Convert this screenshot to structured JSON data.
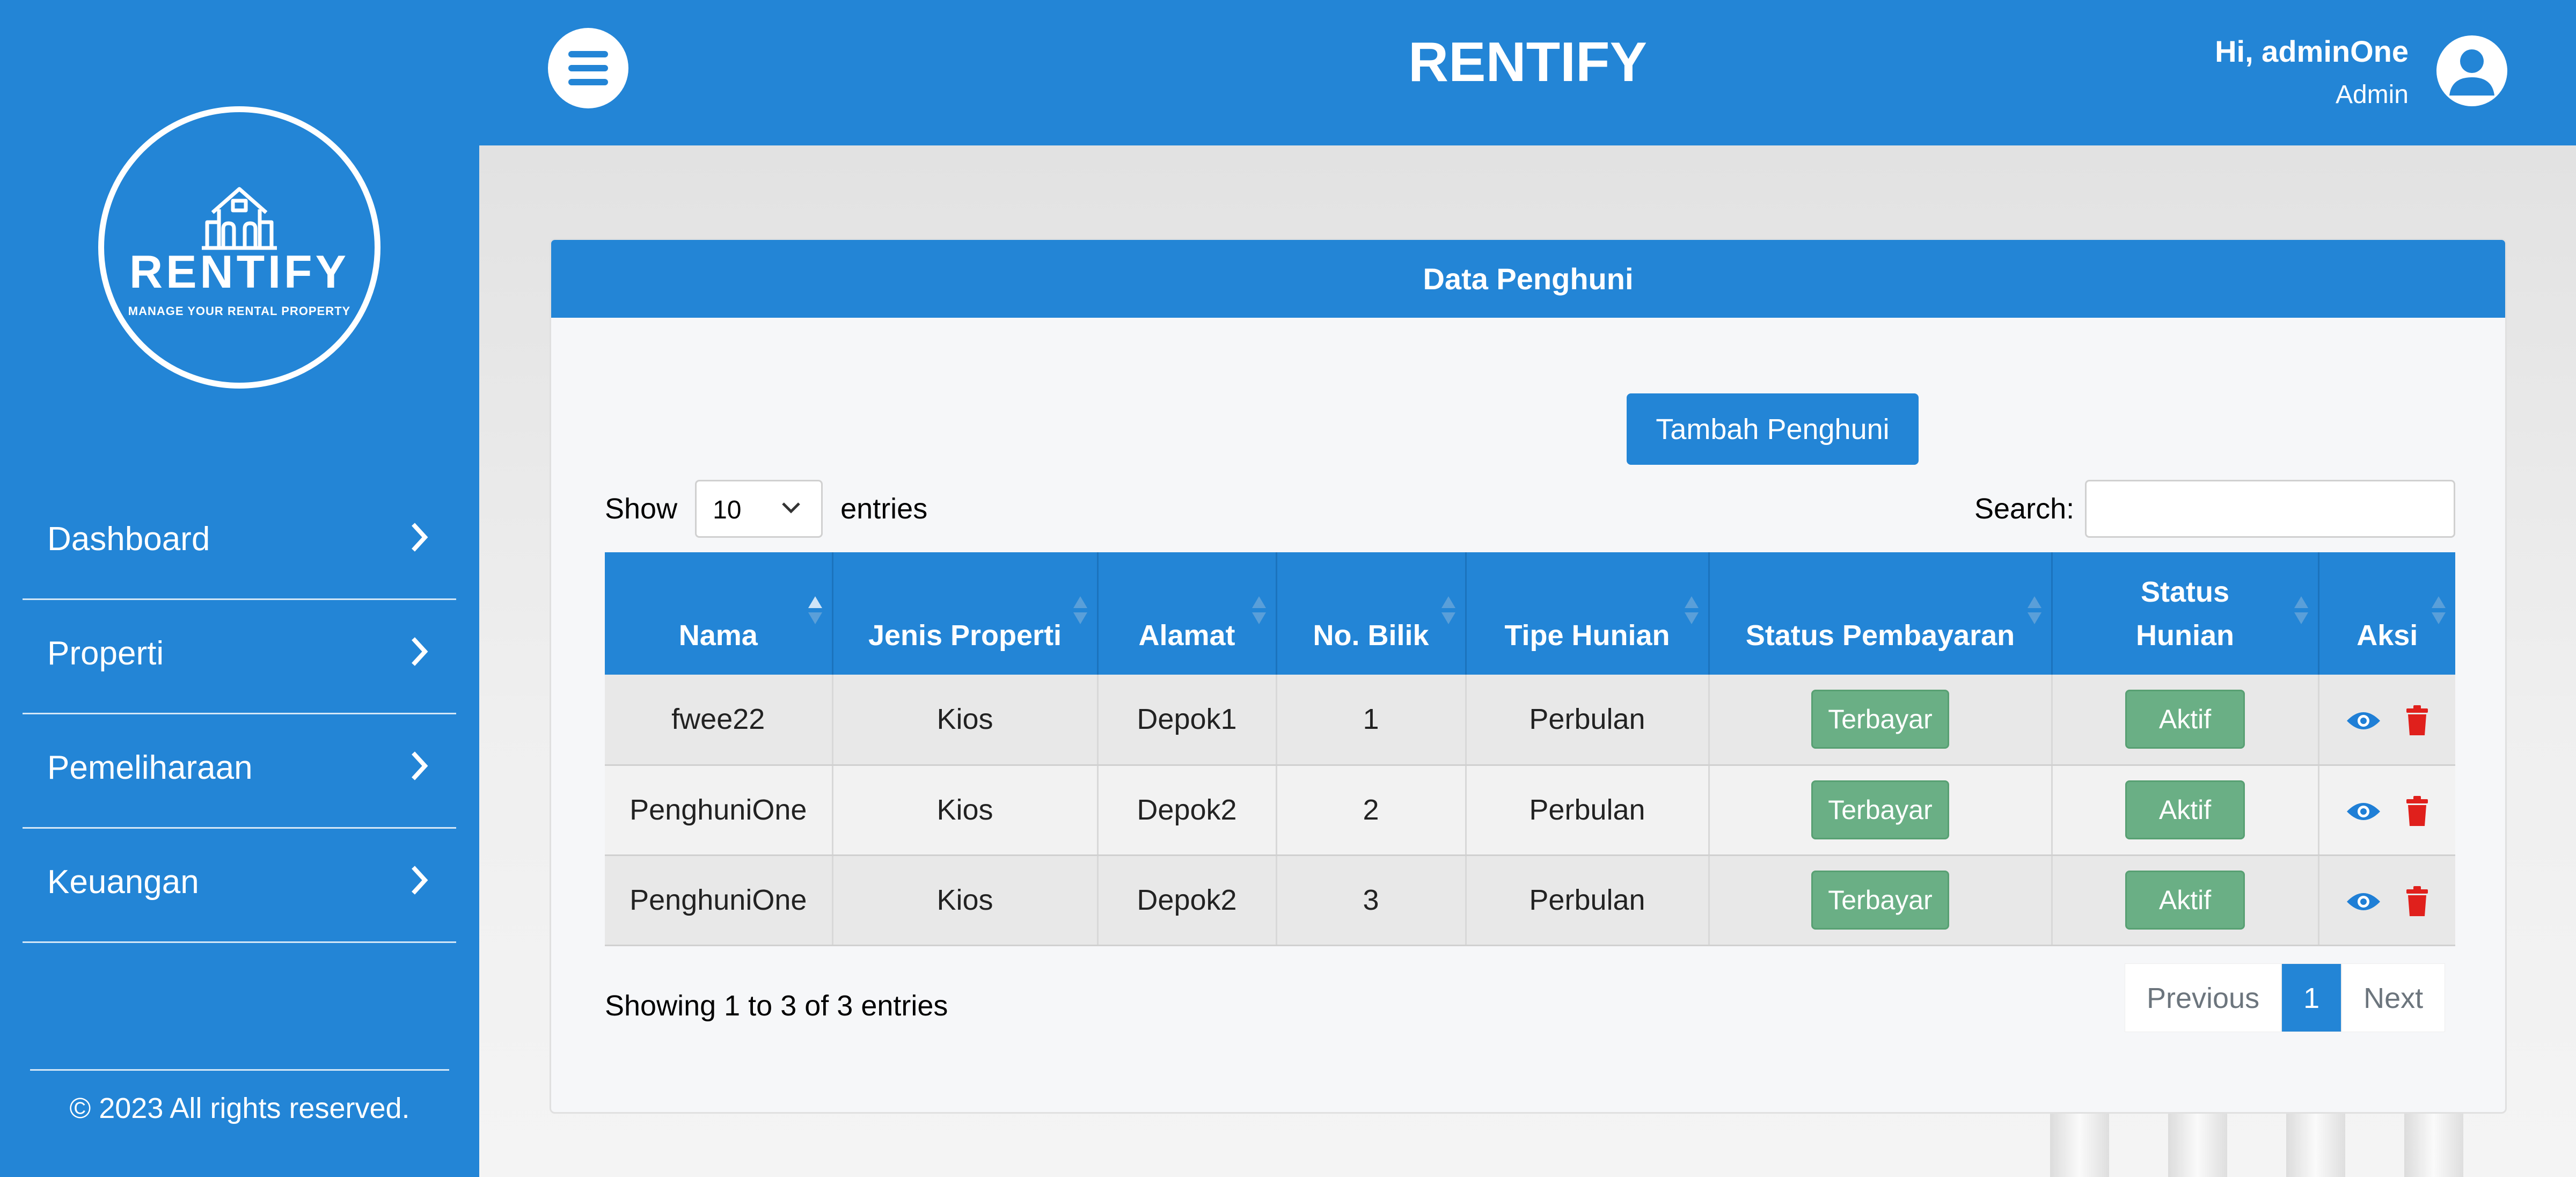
{
  "app": {
    "title": "RENTIFY"
  },
  "colors": {
    "primary": "#2385d6",
    "success_pill": "#6aaf85",
    "danger": "#e0201c"
  },
  "header": {
    "greeting": "Hi, adminOne",
    "role": "Admin",
    "menu_icon": "hamburger-icon",
    "avatar_icon": "user-circle-icon"
  },
  "sidebar": {
    "logo": {
      "word": "RENTIFY",
      "tagline": "MANAGE YOUR RENTAL PROPERTY"
    },
    "items": [
      {
        "label": "Dashboard"
      },
      {
        "label": "Properti"
      },
      {
        "label": "Pemeliharaan"
      },
      {
        "label": "Keuangan"
      }
    ],
    "footer": "© 2023 All rights reserved."
  },
  "card": {
    "title": "Data Penghuni",
    "add_button": "Tambah Penghuni",
    "length": {
      "show": "Show",
      "value": "10",
      "entries": "entries"
    },
    "search_label": "Search:",
    "search_value": "",
    "table": {
      "columns": [
        "Nama",
        "Jenis Properti",
        "Alamat",
        "No. Bilik",
        "Tipe Hunian",
        "Status Pembayaran",
        "Status Hunian",
        "Aksi"
      ],
      "rows": [
        {
          "nama": "fwee22",
          "jenis": "Kios",
          "alamat": "Depok1",
          "bilik": "1",
          "tipe": "Perbulan",
          "pembayaran": "Terbayar",
          "hunian": "Aktif"
        },
        {
          "nama": "PenghuniOne",
          "jenis": "Kios",
          "alamat": "Depok2",
          "bilik": "2",
          "tipe": "Perbulan",
          "pembayaran": "Terbayar",
          "hunian": "Aktif"
        },
        {
          "nama": "PenghuniOne",
          "jenis": "Kios",
          "alamat": "Depok2",
          "bilik": "3",
          "tipe": "Perbulan",
          "pembayaran": "Terbayar",
          "hunian": "Aktif"
        }
      ]
    },
    "info": "Showing 1 to 3 of 3 entries",
    "pagination": {
      "previous": "Previous",
      "current": "1",
      "next": "Next"
    }
  }
}
